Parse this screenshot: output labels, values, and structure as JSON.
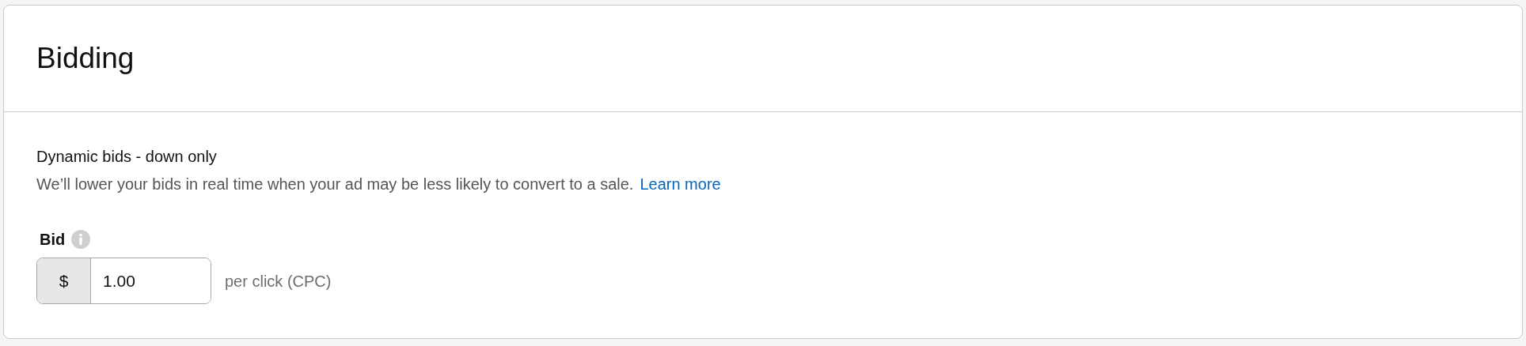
{
  "panel": {
    "title": "Bidding"
  },
  "strategy": {
    "title": "Dynamic bids - down only",
    "description": "We’ll lower your bids in real time when your ad may be less likely to convert to a sale.",
    "link": "Learn more"
  },
  "bid": {
    "label": "Bid",
    "prefix": "$",
    "value": "1.00",
    "suffix": "per click (CPC)"
  }
}
